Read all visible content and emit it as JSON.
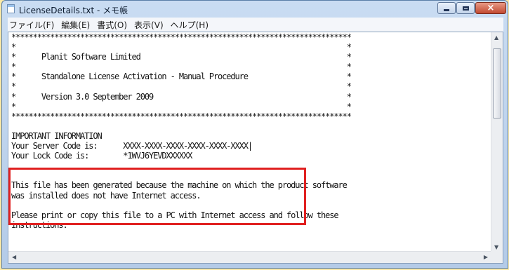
{
  "window": {
    "title": "LicenseDetails.txt - メモ帳",
    "close_glyph": "×"
  },
  "menubar": {
    "items": [
      "ファイル(F)",
      "編集(E)",
      "書式(O)",
      "表示(V)",
      "ヘルプ(H)"
    ]
  },
  "document": {
    "lines": [
      "*******************************************************************************",
      "*                                                                             *",
      "*      Planit Software Limited                                                *",
      "*                                                                             *",
      "*      Standalone License Activation - Manual Procedure                       *",
      "*                                                                             *",
      "*      Version 3.0 September 2009                                             *",
      "*                                                                             *",
      "*******************************************************************************",
      "",
      "IMPORTANT INFORMATION",
      "Your Server Code is:      XXXX-XXXX-XXXX-XXXX-XXXX-XXXX|",
      "Your Lock Code is:        *1WVJ6YEVDXXXXXX",
      "",
      "",
      "This file has been generated because the machine on which the product software",
      "was installed does not have Internet access.",
      "",
      "Please print or copy this file to a PC with Internet access and follow these",
      "instructions."
    ]
  },
  "scrollbar": {
    "up_arrow": "▲",
    "down_arrow": "▼",
    "left_arrow": "◀",
    "right_arrow": "▶"
  },
  "colors": {
    "highlight_border": "#e02020",
    "desktop_background": "#fbe9a6"
  }
}
